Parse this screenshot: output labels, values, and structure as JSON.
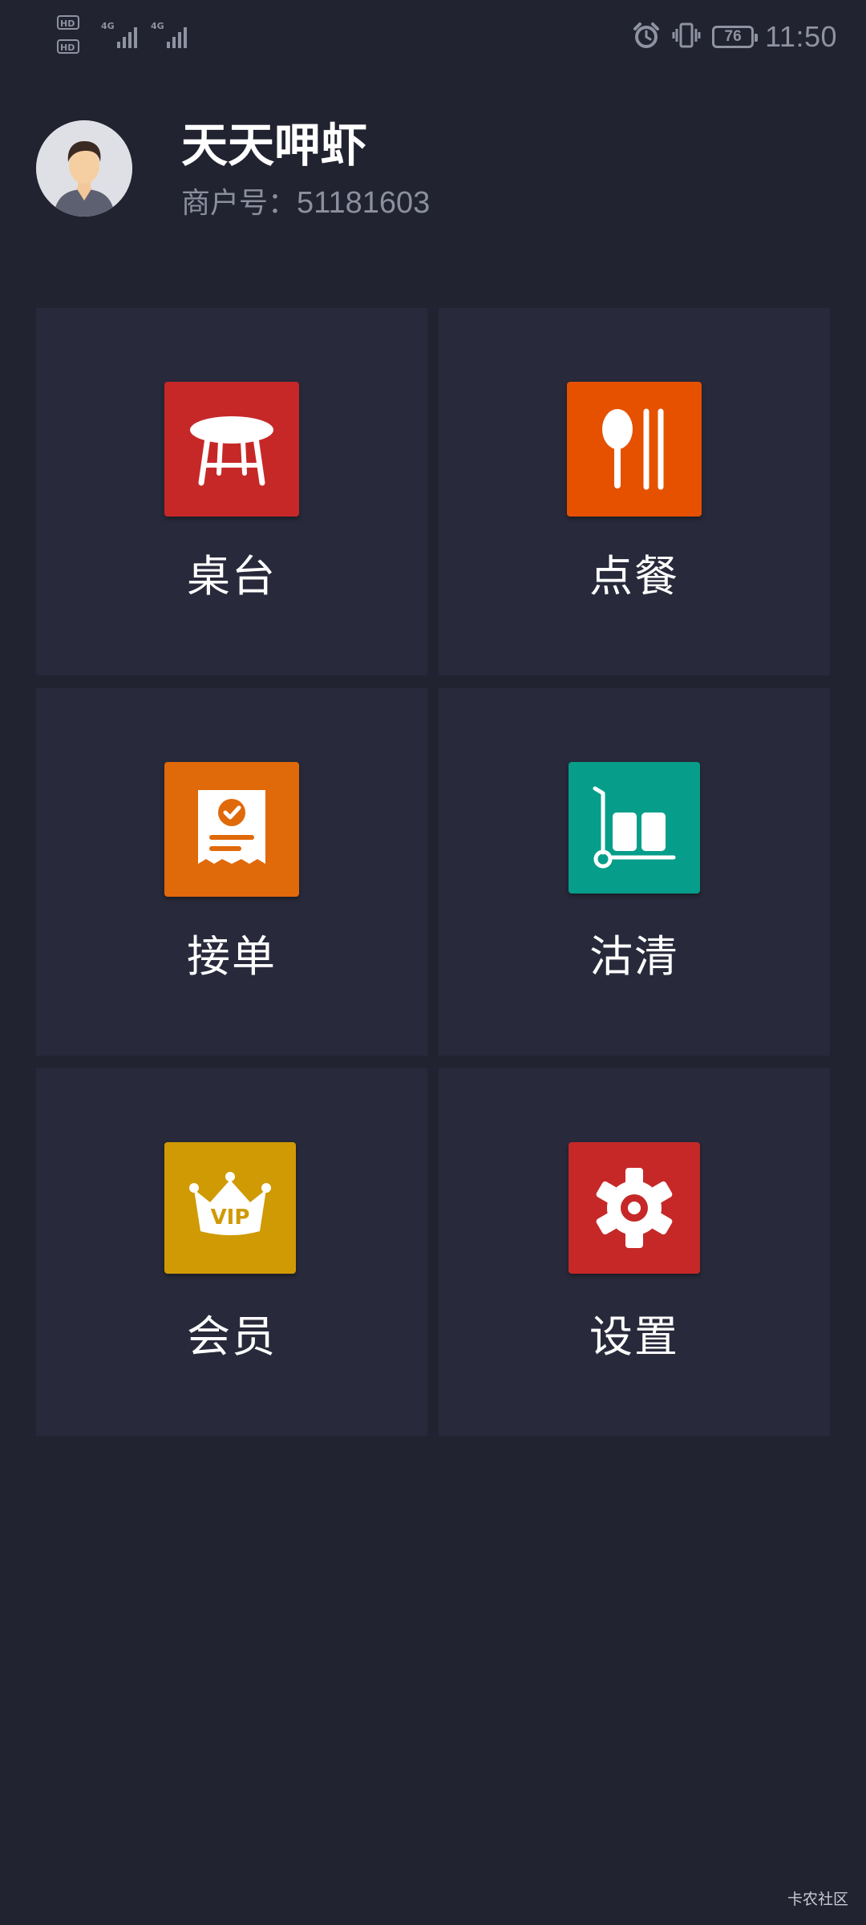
{
  "status_bar": {
    "time": "11:50",
    "battery": "76",
    "left_icons": [
      "hd-icon",
      "signal-4g-icon",
      "signal-4g-icon"
    ],
    "right_icons": [
      "alarm-icon",
      "vibrate-icon",
      "battery-icon"
    ]
  },
  "header": {
    "store_name": "天天呷虾",
    "merchant_label": "商户号：",
    "merchant_id": "51181603"
  },
  "menu": {
    "tiles": [
      {
        "label": "桌台",
        "icon": "table-icon",
        "color": "#c62828"
      },
      {
        "label": "点餐",
        "icon": "spoon-chopsticks-icon",
        "color": "#e65100"
      },
      {
        "label": "接单",
        "icon": "receipt-check-icon",
        "color": "#e0690a"
      },
      {
        "label": "沽清",
        "icon": "hand-truck-icon",
        "color": "#069e8a"
      },
      {
        "label": "会员",
        "icon": "vip-crown-icon",
        "color": "#cf9a04"
      },
      {
        "label": "设置",
        "icon": "gear-icon",
        "color": "#c62828"
      }
    ]
  },
  "watermark": "卡农社区"
}
